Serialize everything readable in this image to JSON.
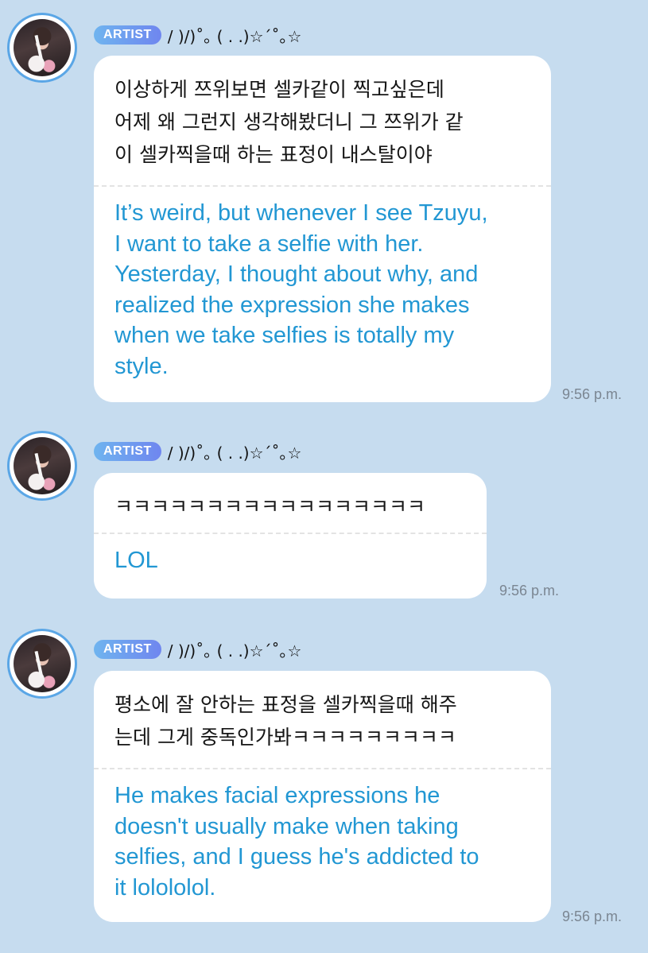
{
  "messages": [
    {
      "badge": "ARTIST",
      "nickname": "/ )/)˚｡ ( . .)☆´˚｡☆",
      "korean": " 이상하게 쯔위보면 셀카같이 찍고싶은데\n어제 왜 그런지 생각해봤더니 그 쯔위가 같\n이 셀카찍을때 하는 표정이 내스탈이야",
      "english": "It’s weird, but whenever I see Tzuyu,\nI want to take a selfie with her.\nYesterday, I thought about why, and\nrealized the expression she makes\nwhen we take selfies is totally my\nstyle.",
      "time": "9:56 p.m."
    },
    {
      "badge": "ARTIST",
      "nickname": "/ )/)˚｡ ( . .)☆´˚｡☆",
      "korean": "ㅋㅋㅋㅋㅋㅋㅋㅋㅋㅋㅋㅋㅋㅋㅋㅋㅋ",
      "english": "LOL",
      "time": "9:56 p.m."
    },
    {
      "badge": "ARTIST",
      "nickname": "/ )/)˚｡ ( . .)☆´˚｡☆",
      "korean": "평소에 잘 안하는 표정을 셀카찍을때 해주\n는데 그게 중독인가봐ㅋㅋㅋㅋㅋㅋㅋㅋㅋ",
      "english": "He makes facial expressions he\ndoesn't usually make when taking\nselfies, and I guess he's addicted to\nit lolololol.",
      "time": "9:56 p.m."
    }
  ],
  "colors": {
    "background": "#c6dcef",
    "translation_text": "#2297d3",
    "avatar_ring": "#5aa6e6"
  }
}
